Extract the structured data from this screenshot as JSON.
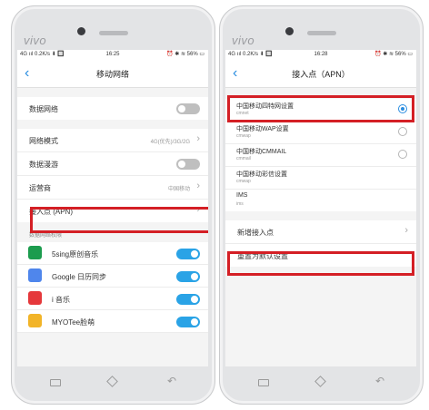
{
  "left": {
    "brand": "vivo",
    "status": {
      "left": "4G ııl 0.2K/s ⬇ 🔲",
      "time": "16:25",
      "right": "⏰ ✱ ≋ 56% ▭"
    },
    "title": "移动网络",
    "rows_top": [
      {
        "label": "数据网络",
        "toggle": "off"
      }
    ],
    "rows_mid": [
      {
        "label": "网络模式",
        "value": "4G(优先)/3G/2G"
      },
      {
        "label": "数据漫游",
        "toggle": "off"
      },
      {
        "label": "运营商",
        "value": "中国移动"
      },
      {
        "label": "接入点 (APN)"
      }
    ],
    "section_label": "数据网络权限",
    "apps": [
      {
        "name": "5sing原创音乐",
        "icon_color": "#1c9c4e",
        "toggle": "on"
      },
      {
        "name": "Google 日历同步",
        "icon_color": "#4f86ec",
        "toggle": "on"
      },
      {
        "name": "i 音乐",
        "icon_color": "#e5383b",
        "toggle": "on"
      },
      {
        "name": "MYOTee脸萌",
        "icon_color": "#f2b428",
        "toggle": "on"
      }
    ]
  },
  "right": {
    "brand": "vivo",
    "status": {
      "left": "4G ııl 0.2K/s ⬇ 🔲",
      "time": "16:28",
      "right": "⏰ ✱ ≋ 56% ▭"
    },
    "title": "接入点（APN）",
    "apns": [
      {
        "name": "中国移动四特网设置",
        "sub": "cmnet",
        "checked": true
      },
      {
        "name": "中国移动WAP设置",
        "sub": "cmwap",
        "checked": false
      },
      {
        "name": "中国移动CMMAIL",
        "sub": "cmmail",
        "checked": false
      },
      {
        "name": "中国移动彩信设置",
        "sub": "cmwap"
      },
      {
        "name": "IMS",
        "sub": "ims"
      }
    ],
    "add_apn": "新增接入点",
    "reset": "重置为默认设置"
  },
  "colors": {
    "accent": "#2a8de0",
    "toggle_on": "#2aa3e6",
    "highlight": "#d41f25"
  }
}
